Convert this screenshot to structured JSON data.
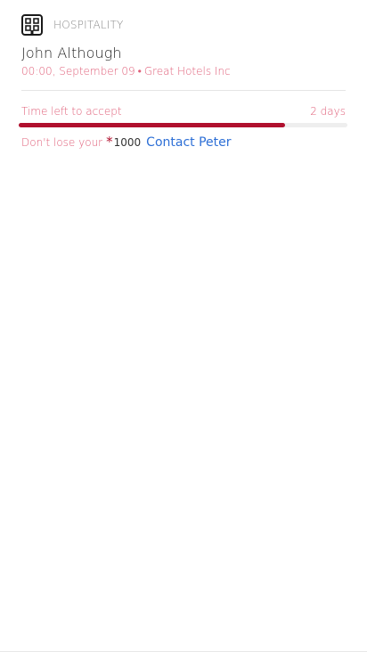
{
  "card": {
    "category": {
      "icon": "building-icon",
      "label": "HOSPITALITY"
    },
    "name": "John Although",
    "meta": {
      "time": "00:00, September 09",
      "separator": "•",
      "company": "Great Hotels Inc"
    },
    "deadline": {
      "label": "Time left to accept",
      "remaining": "2 days",
      "progress_fraction": 0.81
    },
    "reward": {
      "text": "Don't lose your",
      "star_icon": "star-icon",
      "points": "1000",
      "contact_label": "Contact Peter"
    }
  },
  "colors": {
    "accent": "#b0102e",
    "muted_accent": "#e0607a",
    "link": "#2d6fd6",
    "track": "#eeeeee"
  }
}
